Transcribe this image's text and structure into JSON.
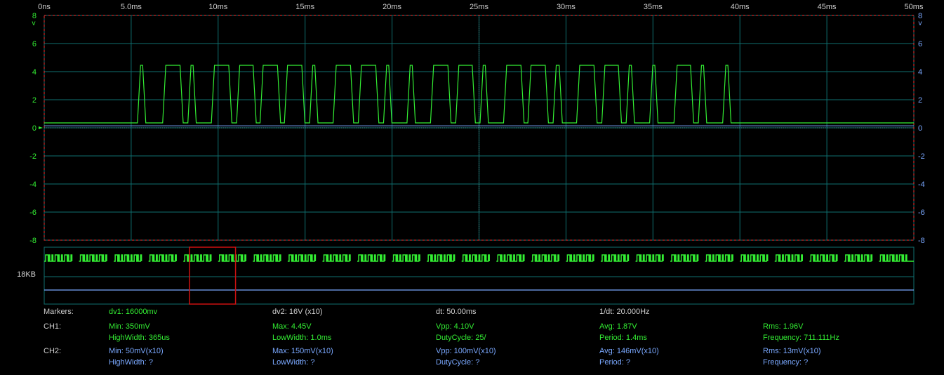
{
  "colors": {
    "background": "#000000",
    "grid": "#0f6f6f",
    "grid_dash": "#ff3030",
    "ch1": "#33ee33",
    "ch2": "#7aa8ff",
    "tick_label": "#d0d0d0",
    "axis_label": "#33ee33",
    "axis_label_right": "#7aa8ff",
    "overview_box": "#cc1111"
  },
  "chart_data": {
    "type": "line",
    "x_unit": "ms",
    "x_ticks": [
      "0ns",
      "5.0ms",
      "10ms",
      "15ms",
      "20ms",
      "25ms",
      "30ms",
      "35ms",
      "40ms",
      "45ms",
      "50ms"
    ],
    "xlim": [
      0,
      50
    ],
    "y_unit": "v",
    "y_ticks_left": [
      "8",
      "6",
      "4",
      "2",
      "0",
      "-2",
      "-4",
      "-6",
      "-8"
    ],
    "y_ticks_right": [
      "8",
      "6",
      "4",
      "2",
      "0",
      "-2",
      "-4",
      "-6",
      "-8"
    ],
    "ylim": [
      -8,
      8
    ],
    "grid": true,
    "series": [
      {
        "name": "CH1",
        "low": 0.35,
        "high": 4.45,
        "pulses_ms": [
          [
            5.45,
            5.75
          ],
          [
            6.9,
            7.9
          ],
          [
            8.35,
            8.65
          ],
          [
            9.7,
            10.7
          ],
          [
            11.15,
            12.1
          ],
          [
            12.5,
            13.5
          ],
          [
            13.9,
            14.9
          ],
          [
            15.35,
            15.65
          ],
          [
            16.7,
            17.7
          ],
          [
            18.15,
            19.15
          ],
          [
            19.6,
            19.9
          ],
          [
            20.95,
            21.25
          ],
          [
            22.3,
            23.3
          ],
          [
            23.75,
            24.7
          ],
          [
            25.15,
            25.45
          ],
          [
            26.5,
            27.5
          ],
          [
            27.9,
            28.9
          ],
          [
            29.35,
            29.7
          ],
          [
            30.7,
            31.7
          ],
          [
            32.15,
            33.1
          ],
          [
            33.55,
            33.85
          ],
          [
            34.9,
            35.2
          ],
          [
            36.3,
            37.25
          ],
          [
            37.7,
            38.0
          ],
          [
            39.1,
            39.4
          ]
        ],
        "overview_bursts": 25
      },
      {
        "name": "CH2",
        "level": 0.146
      }
    ]
  },
  "overview": {
    "size_label": "18KB",
    "view_window_fraction": [
      0.167,
      0.22
    ]
  },
  "measurements": {
    "markers": {
      "label": "Markers:",
      "dv1": "dv1: 16000mv",
      "dv2": "dv2: 16V (x10)",
      "dt": "dt: 50.00ms",
      "inv_dt": "1/dt: 20.000Hz"
    },
    "ch1": {
      "label": "CH1:",
      "min": "Min: 350mV",
      "max": "Max: 4.45V",
      "vpp": "Vpp: 4.10V",
      "avg": "Avg: 1.87V",
      "rms": "Rms: 1.96V",
      "high_width": "HighWidth: 365us",
      "low_width": "LowWidth: 1.0ms",
      "duty_cycle": "DutyCycle: 25/",
      "period": "Period: 1.4ms",
      "frequency": "Frequency: 711.111Hz"
    },
    "ch2": {
      "label": "CH2:",
      "min": "Min: 50mV(x10)",
      "max": "Max: 150mV(x10)",
      "vpp": "Vpp: 100mV(x10)",
      "avg": "Avg: 146mV(x10)",
      "rms": "Rms: 13mV(x10)",
      "high_width": "HighWidth: ?",
      "low_width": "LowWidth: ?",
      "duty_cycle": "DutyCycle: ?",
      "period": "Period: ?",
      "frequency": "Frequency: ?"
    }
  }
}
